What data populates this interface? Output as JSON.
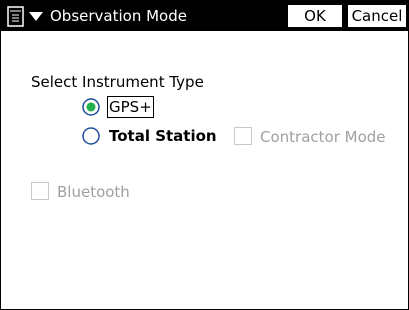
{
  "window": {
    "title": "Observation Mode"
  },
  "toolbar": {
    "menu_icon": "menu-icon",
    "ok_label": "OK",
    "cancel_label": "Cancel"
  },
  "instrument": {
    "section_label": "Select Instrument Type",
    "options": [
      {
        "label": "GPS+",
        "selected": true,
        "focused": true
      },
      {
        "label": "Total Station",
        "selected": false,
        "focused": false
      }
    ],
    "contractor_mode_label": "Contractor Mode",
    "contractor_mode_checked": false,
    "contractor_mode_enabled": false
  },
  "bluetooth": {
    "label": "Bluetooth",
    "checked": false,
    "enabled": false
  },
  "colors": {
    "titlebar_bg": "#000000",
    "titlebar_text": "#ffffff",
    "radio_border": "#1f4f9e",
    "radio_selected": "#22b14c",
    "disabled_text": "#a0a0a0"
  }
}
